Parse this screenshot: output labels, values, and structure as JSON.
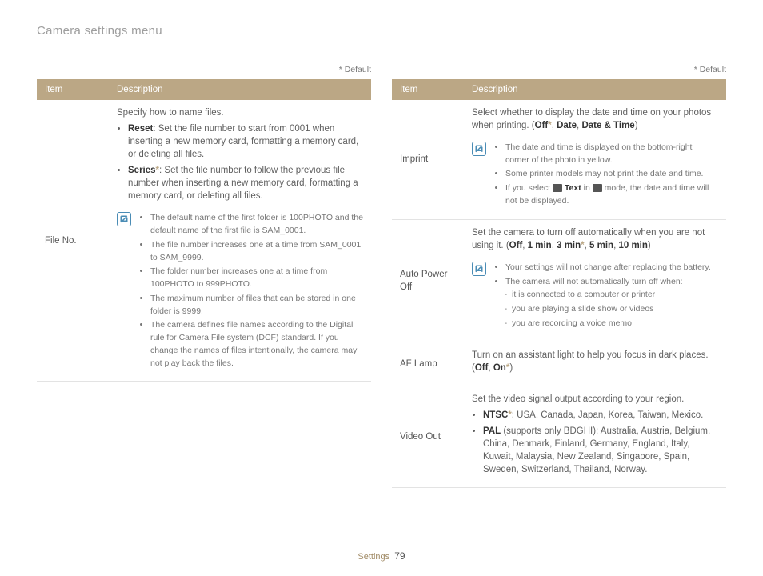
{
  "page_title": "Camera settings menu",
  "default_note": "* Default",
  "headers": {
    "item": "Item",
    "description": "Description"
  },
  "footer": {
    "section": "Settings",
    "page": "79"
  },
  "left": {
    "file_no": {
      "item": "File No.",
      "intro": "Specify how to name files.",
      "reset_label": "Reset",
      "reset_text": ": Set the file number to start from 0001 when inserting a new memory card, formatting a memory card, or deleting all files.",
      "series_label": "Series",
      "series_text": ": Set the file number to follow the previous file number when inserting a new memory card, formatting a memory card, or deleting all files.",
      "notes": [
        "The default name of the first folder is 100PHOTO and the default name of the first file is SAM_0001.",
        "The file number increases one at a time from SAM_0001 to SAM_9999.",
        "The folder number increases one at a time from 100PHOTO to 999PHOTO.",
        "The maximum number of files that can be stored in one folder is 9999.",
        "The camera defines file names according to the Digital rule for Camera File system (DCF) standard. If you change the names of files intentionally, the camera may not play back the files."
      ]
    }
  },
  "right": {
    "imprint": {
      "item": "Imprint",
      "intro_1": "Select whether to display the date and time on your photos when printing. (",
      "off": "Off",
      "date": "Date",
      "datetime": "Date & Time",
      "intro_2": ")",
      "notes_a": "The date and time is displayed on the bottom-right corner of the photo in yellow.",
      "notes_b": "Some printer models may not print the date and time.",
      "notes_c_1": "If you select ",
      "notes_c_text": "Text",
      "notes_c_2": " in ",
      "notes_c_3": " mode, the date and time will not be displayed."
    },
    "auto_power": {
      "item": "Auto Power Off",
      "intro_1": "Set the camera to turn off automatically when you are not using it. (",
      "off": "Off",
      "m1": "1 min",
      "m3": "3 min",
      "m5": "5 min",
      "m10": "10 min",
      "intro_2": ")",
      "notes_a": "Your settings will not change after replacing the battery.",
      "notes_b": "The camera will not automatically turn off when:",
      "sub1": "it is connected to a computer or printer",
      "sub2": "you are playing a slide show or videos",
      "sub3": "you are recording a voice memo"
    },
    "af_lamp": {
      "item": "AF Lamp",
      "intro_1": "Turn on an assistant light to help you focus in dark places. (",
      "off": "Off",
      "on": "On",
      "intro_2": ")"
    },
    "video_out": {
      "item": "Video Out",
      "intro": "Set the video signal output according to your region.",
      "ntsc_label": "NTSC",
      "ntsc_text": ": USA, Canada, Japan, Korea, Taiwan, Mexico.",
      "pal_label": "PAL",
      "pal_text": " (supports only BDGHI): Australia, Austria, Belgium, China, Denmark, Finland, Germany, England, Italy, Kuwait, Malaysia, New Zealand, Singapore, Spain, Sweden, Switzerland, Thailand, Norway."
    }
  }
}
